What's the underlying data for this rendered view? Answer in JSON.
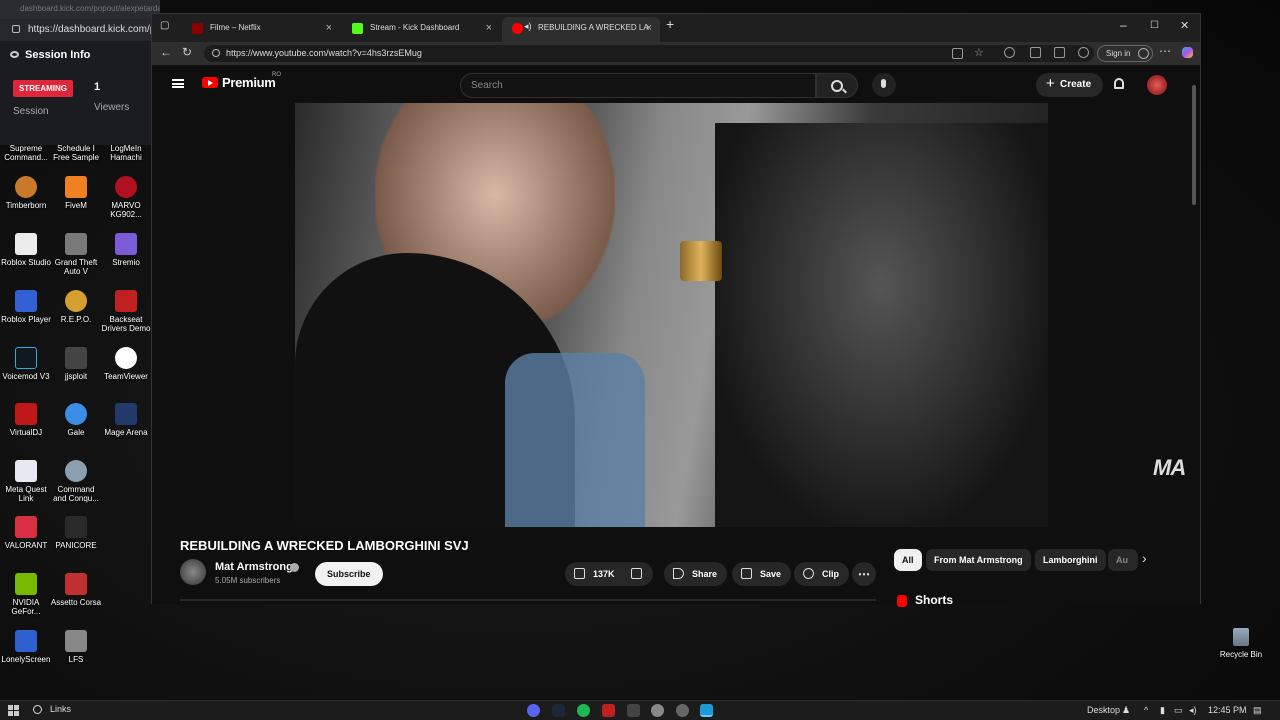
{
  "kick": {
    "top_text": "dashboard.kick.com/popout/alexpetarda/session-info - Per",
    "url": "https://dashboard.kick.com/p",
    "title": "Session Info",
    "badge": "STREAMING",
    "session_label": "Session",
    "viewers_count": "1",
    "viewers_label": "Viewers"
  },
  "desktop_icons": [
    {
      "label": "Supreme Command...",
      "color": "#3a3a3a"
    },
    {
      "label": "Schedule I Free Sample",
      "color": "#3a3a3a"
    },
    {
      "label": "LogMeIn Hamachi",
      "color": "#3a3a3a"
    },
    {
      "label": "Timberborn",
      "color": "#c87a2a"
    },
    {
      "label": "FiveM",
      "color": "#f08020"
    },
    {
      "label": "MARVO KG902...",
      "color": "#b01020"
    },
    {
      "label": "Roblox Studio",
      "color": "#ececec"
    },
    {
      "label": "Grand Theft Auto V",
      "color": "#7a7a7a"
    },
    {
      "label": "Stremio",
      "color": "#7b5cd6"
    },
    {
      "label": "Roblox Player",
      "color": "#335fd6"
    },
    {
      "label": "R.E.P.O.",
      "color": "#d6a030"
    },
    {
      "label": "Backseat Drivers Demo",
      "color": "#c02020"
    },
    {
      "label": "Voicemod V3",
      "color": "#101820"
    },
    {
      "label": "jjsploit",
      "color": "#444"
    },
    {
      "label": "TeamViewer",
      "color": "#ffffff"
    },
    {
      "label": "VirtualDJ",
      "color": "#c01818"
    },
    {
      "label": "Gale",
      "color": "#3a8ee6"
    },
    {
      "label": "Mage Arena",
      "color": "#223a6a"
    },
    {
      "label": "Meta Quest Link",
      "color": "#e8e8f0"
    },
    {
      "label": "Command and Conqu...",
      "color": "#8aa0b0"
    },
    {
      "label": "VALORANT",
      "color": "#d83040"
    },
    {
      "label": "PANICORE",
      "color": "#2a2a2a"
    },
    {
      "label": "NVIDIA GeFor...",
      "color": "#76b900"
    },
    {
      "label": "Assetto Corsa",
      "color": "#c03030"
    },
    {
      "label": "LonelyScreen",
      "color": "#3060d0"
    },
    {
      "label": "LFS",
      "color": "#888"
    }
  ],
  "browser": {
    "tabs": [
      {
        "label": "Filme – Netflix",
        "fav_color": "#8b0000"
      },
      {
        "label": "Stream - Kick Dashboard",
        "fav_color": "#53fc18"
      },
      {
        "label": "REBUILDING A WRECKED LA",
        "fav_color": "#ff0000"
      }
    ],
    "url": "https://www.youtube.com/watch?v=4hs3rzsEMug",
    "sign_in": "Sign in",
    "win_min": "–",
    "win_max": "☐",
    "win_close": "✕",
    "new_tab": "+"
  },
  "youtube": {
    "brand": "Premium",
    "region": "RO",
    "search_placeholder": "Search",
    "create_label": "Create",
    "video_title": "REBUILDING A WRECKED LAMBORGHINI SVJ",
    "watermark": "MA",
    "channel_name": "Mat Armstrong",
    "subscribers": "5.05M subscribers",
    "subscribe_label": "Subscribe",
    "likes": "137K",
    "share_label": "Share",
    "save_label": "Save",
    "clip_label": "Clip",
    "more_label": "⋯",
    "chips": [
      "All",
      "From Mat Armstrong",
      "Lamborghini",
      "Au"
    ],
    "chips_next": "›",
    "shorts_label": "Shorts"
  },
  "taskbar": {
    "search_label": "Links",
    "desktop_label": "Desktop",
    "time": "12:45 PM",
    "recycle_bin": "Recycle Bin",
    "apps": [
      {
        "name": "discord-icon",
        "color": "#5865f2"
      },
      {
        "name": "steam-icon",
        "color": "#1b2838"
      },
      {
        "name": "spotify-icon",
        "color": "#1db954"
      },
      {
        "name": "app-icon",
        "color": "#c02020"
      },
      {
        "name": "app-icon",
        "color": "#444"
      },
      {
        "name": "chrome-icon",
        "color": "#888"
      },
      {
        "name": "app-icon",
        "color": "#666"
      },
      {
        "name": "edge-icon",
        "color": "#1e9bd6"
      }
    ]
  }
}
